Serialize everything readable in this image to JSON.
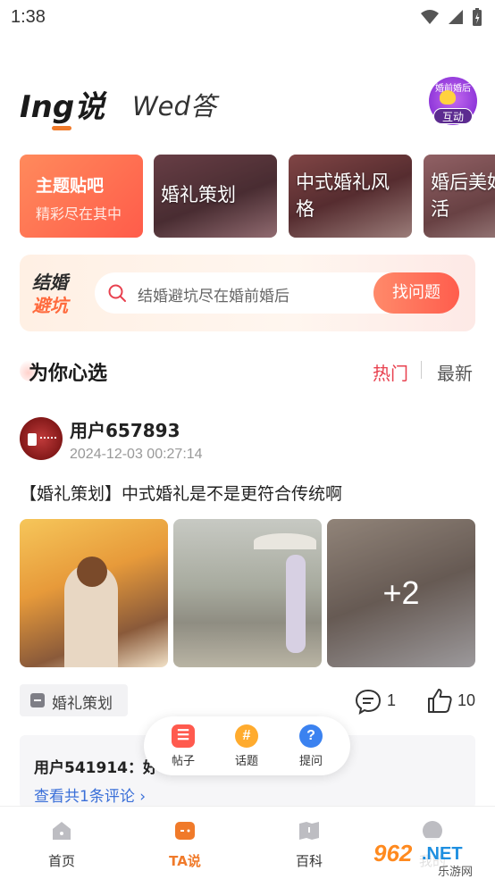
{
  "status_bar": {
    "time": "1:38"
  },
  "header": {
    "tabs": [
      {
        "label": "Ing说",
        "active": true
      },
      {
        "label": "Wed答",
        "active": false
      }
    ],
    "interact_avatar": {
      "top_text": "婚前婚后",
      "badge": "互动"
    }
  },
  "categories": {
    "featured": {
      "title": "主题贴吧",
      "subtitle": "精彩尽在其中"
    },
    "items": [
      {
        "label": "婚礼策划"
      },
      {
        "label": "中式婚礼风格"
      },
      {
        "label": "婚后美好生活"
      }
    ]
  },
  "search_banner": {
    "logo_line1": "结婚",
    "logo_line2": "避坑",
    "placeholder": "结婚避坑尽在婚前婚后",
    "button": "找问题"
  },
  "section": {
    "title": "为你心选",
    "sort_hot": "热门",
    "sort_new": "最新"
  },
  "post": {
    "username": "用户657893",
    "time": "2024-12-03 00:27:14",
    "title": "【婚礼策划】中式婚礼是不是更符合传统啊",
    "more_images": "+2",
    "topic": "婚礼策划",
    "comment_count": "1",
    "like_count": "10",
    "top_comment": "用户541914：好",
    "view_comments": "查看共1条评论 ›"
  },
  "fab_menu": {
    "items": [
      {
        "label": "帖子",
        "glyph": "☰"
      },
      {
        "label": "话题",
        "glyph": "#"
      },
      {
        "label": "提问",
        "glyph": "?"
      }
    ]
  },
  "bottom_nav": {
    "items": [
      {
        "label": "首页",
        "active": false
      },
      {
        "label": "TA说",
        "active": true
      },
      {
        "label": "百科",
        "active": false
      },
      {
        "label": "我的",
        "active": false
      }
    ]
  },
  "watermark": {
    "number": "962",
    "suffix": ".NET",
    "sub": "乐游网"
  },
  "colors": {
    "accent": "#f07a2a",
    "hot": "#e8414f",
    "link": "#3a6fd8",
    "search_button": "#ff5d4d"
  }
}
